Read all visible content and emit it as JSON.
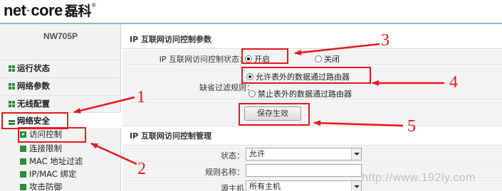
{
  "header": {
    "brand_prefix": "net",
    "brand_dot": "·",
    "brand_suffix": "core",
    "brand_cn": "磊科",
    "trademark": "®"
  },
  "sidebar": {
    "model": "NW705P",
    "items": [
      {
        "label": "运行状态"
      },
      {
        "label": "网络参数"
      },
      {
        "label": "无线配置"
      },
      {
        "label": "网络安全"
      }
    ],
    "sub_items": [
      {
        "label": "访问控制"
      },
      {
        "label": "连接限制"
      },
      {
        "label": "MAC 地址过滤"
      },
      {
        "label": "IP/MAC 绑定"
      },
      {
        "label": "攻击防御"
      }
    ]
  },
  "params": {
    "title": "IP 互联网访问控制参数",
    "status_label": "IP 互联网访问控制状态：",
    "status_on": "开启",
    "status_off": "关闭",
    "default_rule_label": "缺省过滤规则：",
    "rule_allow": "允许表外的数据通过路由器",
    "rule_deny": "禁止表外的数据通过路由器",
    "save_button": "保存生效"
  },
  "manage": {
    "title": "IP 互联网访问控制管理",
    "state_label": "状态：",
    "state_value": "允许",
    "rule_name_label": "规则名称：",
    "rule_name_value": "",
    "source_label": "源主机",
    "source_value": "所有主机"
  },
  "annotations": {
    "n1": "1",
    "n2": "2",
    "n3": "3",
    "n4": "4",
    "n5": "5",
    "color": "#e8171b"
  },
  "watermark": "http://www.192ly.com"
}
